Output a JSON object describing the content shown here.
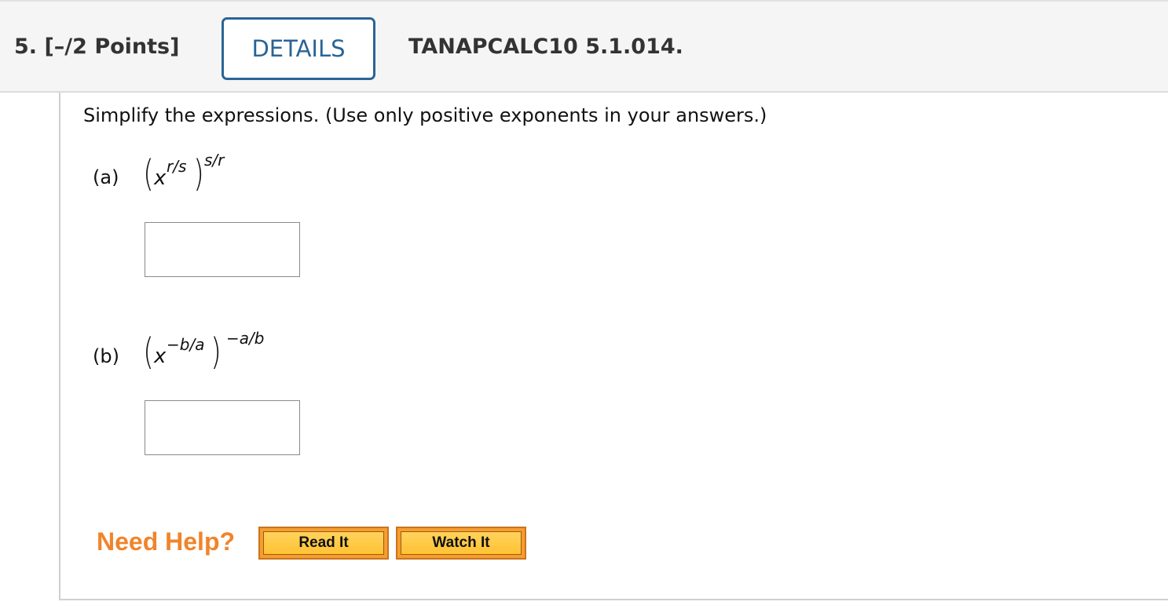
{
  "question": {
    "number": "5.",
    "points": "[–/2 Points]",
    "details_label": "DETAILS",
    "code": "TANAPCALC10 5.1.014."
  },
  "instructions": "Simplify the expressions. (Use only positive exponents in your answers.)",
  "parts": [
    {
      "label": "(a)",
      "base": "x",
      "inner_exponent": "r/s",
      "outer_exponent": "s/r",
      "answer_value": ""
    },
    {
      "label": "(b)",
      "base": "x",
      "inner_exponent": "−b/a",
      "outer_exponent": "−a/b",
      "answer_value": ""
    }
  ],
  "help": {
    "label": "Need Help?",
    "read_it": "Read It",
    "watch_it": "Watch It"
  },
  "colors": {
    "details_border": "#2a6496",
    "need_help": "#f0842b",
    "help_button": "#ffc233"
  }
}
